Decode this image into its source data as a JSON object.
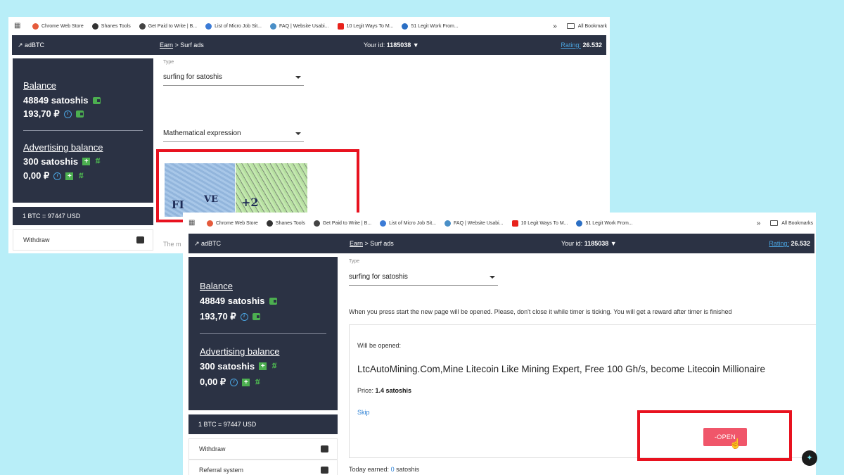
{
  "bookmarks": [
    {
      "label": "Chrome Web Store",
      "color": "#e55b3c"
    },
    {
      "label": "Shanes Tools",
      "color": "#333333"
    },
    {
      "label": "Get Paid to Write | B...",
      "color": "#444444"
    },
    {
      "label": "List of Micro Job Sit...",
      "color": "#3b7bd6"
    },
    {
      "label": "FAQ | Website Usabi...",
      "color": "#4a8fc7"
    },
    {
      "label": "10 Legit Ways To M...",
      "color": "#e8221b"
    },
    {
      "label": "51 Legit Work From...",
      "color": "#2b6fc4"
    }
  ],
  "bookmarks_more": "»",
  "all_bookmarks": "All Bookmarks",
  "all_bookmarks_cut": "All Bookmark",
  "topbar": {
    "logo": "↗ adBTC",
    "crumb_earn": "Earn",
    "crumb_rest": " > Surf ads",
    "your_id_label": "Your id:",
    "your_id": "1185038 ▼",
    "rating_label": "Rating:",
    "rating_value": "26.532"
  },
  "balance": {
    "title": "Balance",
    "satoshis": "48849 satoshis",
    "rub": "193,70 ₽",
    "adv_title": "Advertising balance",
    "adv_satoshis": "300 satoshis",
    "adv_rub": "0,00 ₽"
  },
  "rate": "1 BTC = 97447 USD",
  "menu": {
    "withdraw": "Withdraw",
    "referral": "Referral system"
  },
  "form": {
    "type_label": "Type",
    "type_value": "surfing for  satoshis",
    "captcha_type": "Mathematical expression",
    "captcha_text_a": "FI",
    "captcha_text_b": "VE",
    "captcha_text_c": "+2",
    "cut_text": "The m"
  },
  "surf": {
    "notice": "When you press start the new page will be opened. Please, don't close it while timer is ticking. You will get a reward after timer is finished",
    "will_be_opened": "Will be opened:",
    "site_title": "LtcAutoMining.Com,Mine Litecoin Like Mining Expert, Free 100 Gh/s, become Litecoin Millionaire",
    "price_label": "Price:",
    "price_value": "1.4 satoshis",
    "skip": "Skip",
    "open_button": "-OPEN",
    "today_label": "Today earned:",
    "today_value": "0",
    "today_unit": "satoshis"
  },
  "colors": {
    "background": "#b8eef8",
    "dark_panel": "#2b3244",
    "highlight": "#e8121f",
    "open_button": "#f0566a",
    "accent_green": "#4caf50",
    "link_blue": "#2a7fd4"
  }
}
